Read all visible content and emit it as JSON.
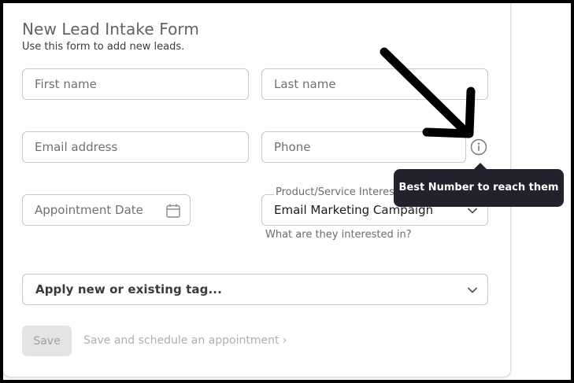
{
  "form": {
    "title": "New Lead Intake Form",
    "subtitle": "Use this form to add new leads."
  },
  "fields": {
    "first_name_placeholder": "First name",
    "last_name_placeholder": "Last name",
    "email_placeholder": "Email address",
    "phone_placeholder": "Phone",
    "appointment_placeholder": "Appointment Date"
  },
  "product": {
    "label": "Product/Service Interest",
    "value": "Email Marketing Campaign",
    "helper": "What are they interested in?"
  },
  "tags": {
    "placeholder": "Apply new or existing tag..."
  },
  "actions": {
    "save_label": "Save",
    "schedule_label": "Save and schedule an appointment ›"
  },
  "tooltip": {
    "text": "Best Number to reach them"
  },
  "icons": [
    "calendar-icon",
    "chevron-down-icon",
    "info-icon",
    "annotation-arrow"
  ],
  "colors": {
    "tooltip_bg": "#22212c",
    "border": "#c8c8c8",
    "disabled_button": "#e4e4e4"
  }
}
